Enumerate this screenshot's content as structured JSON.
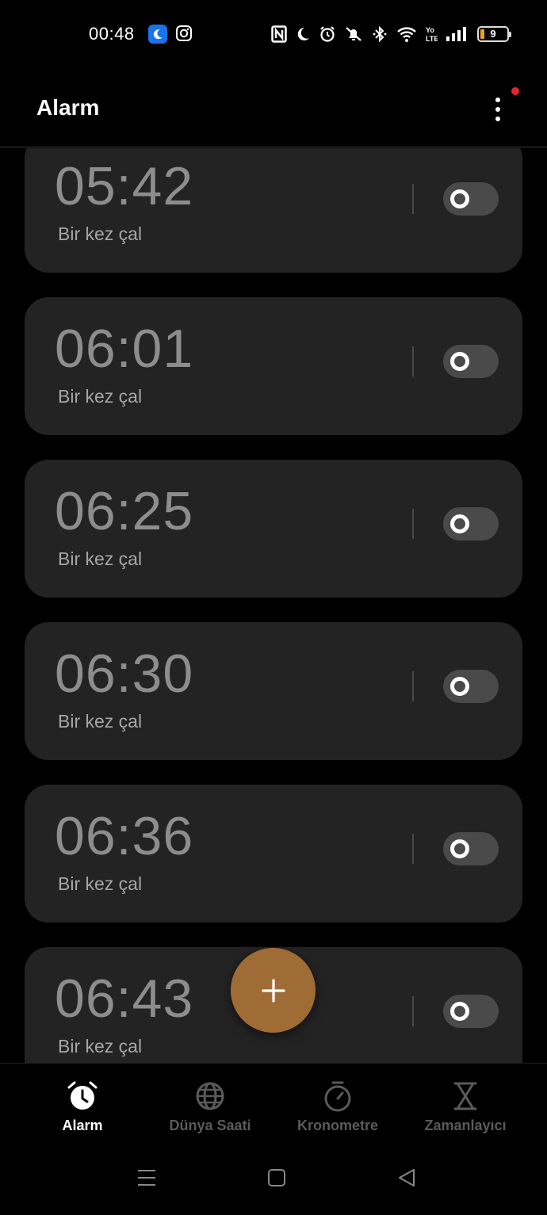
{
  "status_bar": {
    "time": "00:48",
    "battery_level": "9",
    "icons": [
      "moon-app-icon",
      "instagram-icon",
      "nfc-icon",
      "moon-icon",
      "alarm-icon",
      "mute-icon",
      "bluetooth-icon",
      "wifi-icon",
      "volte-icon",
      "signal-icon",
      "battery-icon"
    ]
  },
  "header": {
    "title": "Alarm",
    "menu_icon": "more-vertical-icon",
    "notification_color": "#e3242b"
  },
  "alarms": [
    {
      "time": "05:42",
      "repeat": "Bir kez çal",
      "enabled": false
    },
    {
      "time": "06:01",
      "repeat": "Bir kez çal",
      "enabled": false
    },
    {
      "time": "06:25",
      "repeat": "Bir kez çal",
      "enabled": false
    },
    {
      "time": "06:30",
      "repeat": "Bir kez çal",
      "enabled": false
    },
    {
      "time": "06:36",
      "repeat": "Bir kez çal",
      "enabled": false
    },
    {
      "time": "06:43",
      "repeat": "Bir kez çal",
      "enabled": false
    }
  ],
  "fab": {
    "icon": "plus-icon",
    "color": "#a06c36"
  },
  "bottom_nav": {
    "items": [
      {
        "label": "Alarm",
        "icon": "alarm-clock-icon",
        "active": true
      },
      {
        "label": "Dünya Saati",
        "icon": "globe-icon",
        "active": false
      },
      {
        "label": "Kronometre",
        "icon": "stopwatch-icon",
        "active": false
      },
      {
        "label": "Zamanlayıcı",
        "icon": "hourglass-icon",
        "active": false
      }
    ]
  },
  "system_nav": [
    "menu-icon",
    "home-icon",
    "back-icon"
  ]
}
